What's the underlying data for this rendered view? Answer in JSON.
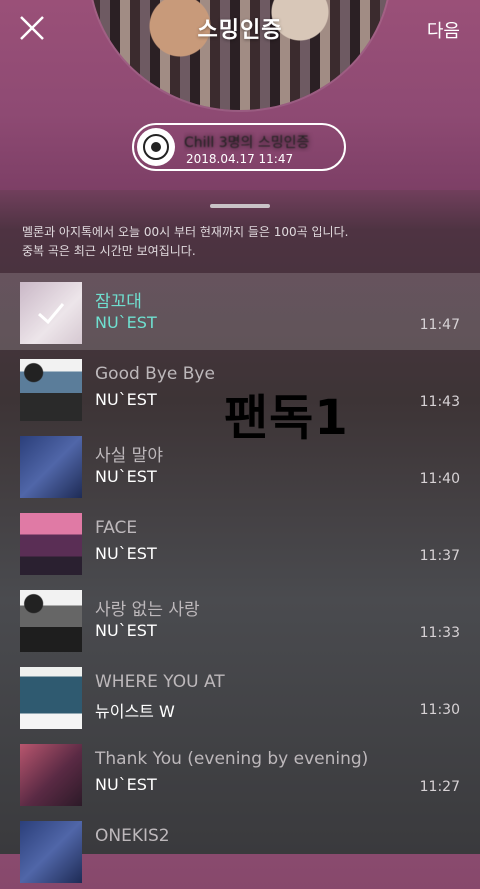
{
  "header": {
    "title": "스밍인증",
    "next_label": "다음",
    "badge_title": "Chill 3명의 스밍인증",
    "badge_date": "2018.04.17 11:47"
  },
  "notice": {
    "line1": "멜론과 아지톡에서 오늘 00시 부터 현재까지 들은 100곡 입니다.",
    "line2": "중복 곡은 최근 시간만 보여집니다."
  },
  "watermark": "팬독1",
  "songs": [
    {
      "title": "잠꼬대",
      "artist": "NU`EST",
      "time": "11:47",
      "active": true
    },
    {
      "title": "Good Bye Bye",
      "artist": "NU`EST",
      "time": "11:43"
    },
    {
      "title": "사실 말야",
      "artist": "NU`EST",
      "time": "11:40"
    },
    {
      "title": "FACE",
      "artist": "NU`EST",
      "time": "11:37"
    },
    {
      "title": "사랑 없는 사랑",
      "artist": "NU`EST",
      "time": "11:33"
    },
    {
      "title": "WHERE YOU AT",
      "artist": "뉴이스트 W",
      "time": "11:30"
    },
    {
      "title": "Thank You (evening by evening)",
      "artist": "NU`EST",
      "time": "11:27"
    },
    {
      "title": "ONEKIS2",
      "artist": "",
      "time": ""
    }
  ],
  "colors": {
    "accent": "#6fe0d0",
    "header_bg": "#8e4a73"
  }
}
